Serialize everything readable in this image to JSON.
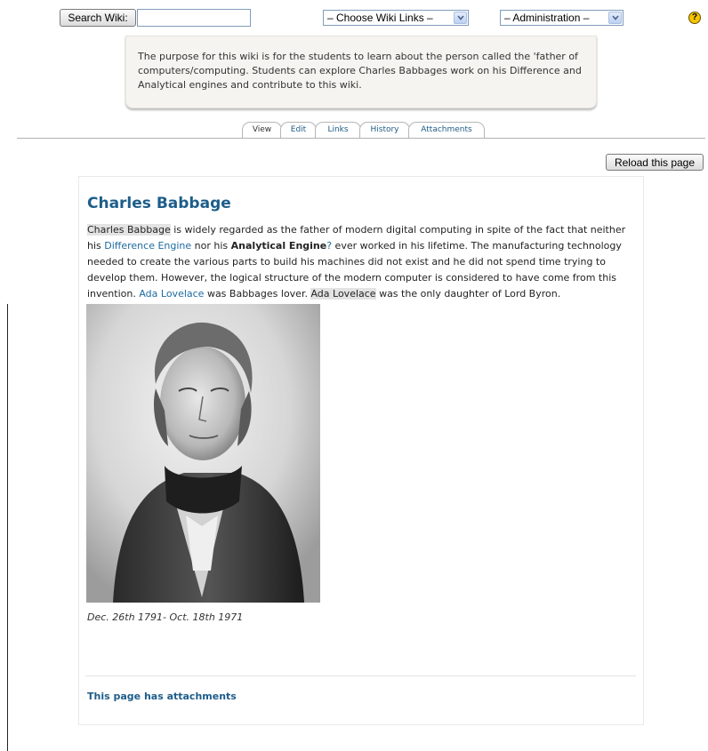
{
  "toolbar": {
    "search_label": "Search Wiki:",
    "search_value": "",
    "wiki_links_select": "– Choose Wiki Links –",
    "administration_select": "– Administration –",
    "help_glyph": "?",
    "help_icon": "help-icon"
  },
  "intro": {
    "text": "The purpose for this wiki is for the students to learn about the person called the 'father of computers/computing. Students can explore Charles Babbages work on  his Difference and Analytical engines and contribute to this wiki."
  },
  "tabs": [
    {
      "label": "View"
    },
    {
      "label": "Edit"
    },
    {
      "label": "Links"
    },
    {
      "label": "History"
    },
    {
      "label": "Attachments"
    }
  ],
  "reload_label": "Reload this page",
  "article": {
    "title": "Charles Babbage",
    "p1": "Charles Babbage",
    "p2": " is widely regarded as the father of modern digital computing in spite of the fact that neither his ",
    "link_difference": "Difference Engine",
    "p3": " nor his ",
    "bold_analytical": "Analytical Engine",
    "link_question": "?",
    "p4": " ever worked in his lifetime. The manufacturing technology needed to create the various parts to build his machines did not exist and he did not spend time trying to develop them. However, the logical structure of the modern computer is considered to have come from this invention. ",
    "link_ada": "Ada Lovelace",
    "p5": " was Babbages lover. ",
    "hl_ada": "Ada Lovelace",
    "p6": " was the only daughter of Lord Byron.",
    "caption": "Dec. 26th 1791- Oct. 18th 1971",
    "attachments_note": "This page has attachments"
  },
  "colors": {
    "title_blue": "#1d5d8a",
    "link_blue": "#1d6ba1",
    "intro_bg": "#f5f4f0"
  }
}
